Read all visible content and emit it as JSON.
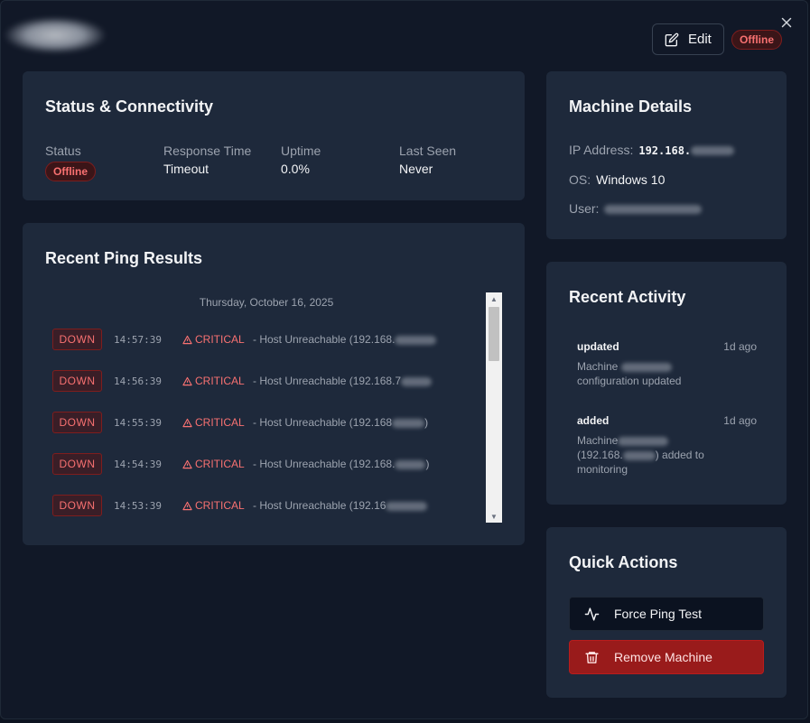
{
  "header": {
    "edit_label": "Edit",
    "status_badge": "Offline"
  },
  "status_card": {
    "title": "Status & Connectivity",
    "status_label": "Status",
    "status_value": "Offline",
    "response_label": "Response Time",
    "response_value": "Timeout",
    "uptime_label": "Uptime",
    "uptime_value": "0.0%",
    "last_seen_label": "Last Seen",
    "last_seen_value": "Never"
  },
  "ping_card": {
    "title": "Recent Ping Results",
    "date": "Thursday, October 16, 2025",
    "rows": [
      {
        "state": "DOWN",
        "time": "14:57:39",
        "severity": "CRITICAL",
        "message": "- Host Unreachable (192.168."
      },
      {
        "state": "DOWN",
        "time": "14:56:39",
        "severity": "CRITICAL",
        "message": "- Host Unreachable (192.168.7"
      },
      {
        "state": "DOWN",
        "time": "14:55:39",
        "severity": "CRITICAL",
        "message": "- Host Unreachable (192.168"
      },
      {
        "state": "DOWN",
        "time": "14:54:39",
        "severity": "CRITICAL",
        "message": "- Host Unreachable (192.168."
      },
      {
        "state": "DOWN",
        "time": "14:53:39",
        "severity": "CRITICAL",
        "message": "- Host Unreachable (192.16"
      }
    ]
  },
  "details_card": {
    "title": "Machine Details",
    "ip_label": "IP Address:",
    "ip_value": "192.168.",
    "os_label": "OS:",
    "os_value": "Windows 10",
    "user_label": "User:"
  },
  "activity_card": {
    "title": "Recent Activity",
    "items": [
      {
        "type": "updated",
        "ago": "1d ago",
        "desc_a": "Machine ",
        "desc_b": "configuration updated"
      },
      {
        "type": "added",
        "ago": "1d ago",
        "desc_a": "Machine",
        "desc_b": "(192.168.",
        "desc_c": ") added to monitoring"
      }
    ]
  },
  "quick_actions": {
    "title": "Quick Actions",
    "force_ping_label": "Force Ping Test",
    "remove_label": "Remove Machine"
  },
  "colors": {
    "background": "#111827",
    "card": "#1e293b",
    "danger": "#f87171",
    "remove_button": "#991b1b"
  }
}
